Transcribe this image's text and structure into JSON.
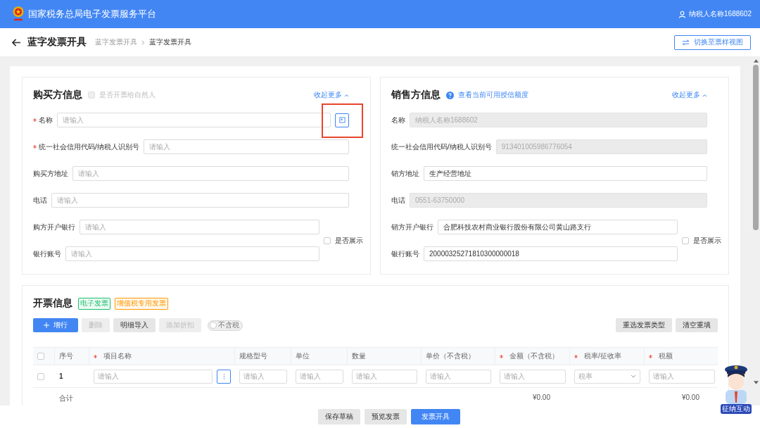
{
  "header": {
    "title": "国家税务总局电子发票服务平台",
    "user": "纳税人名称1688602"
  },
  "page": {
    "title": "蓝字发票开具",
    "breadcrumb": [
      {
        "label": "蓝字发票开具",
        "current": false
      },
      {
        "label": "蓝字发票开具",
        "current": true
      }
    ],
    "switch_button": "切换至票样视图"
  },
  "buyer": {
    "title": "购买方信息",
    "natural_person": {
      "label": "是否开票给自然人",
      "checked": false,
      "disabled": true
    },
    "collapse_link": "收起更多",
    "fields": [
      {
        "label": "名称",
        "required": true,
        "placeholder": "请输入",
        "picker": true,
        "highlighted": true
      },
      {
        "label": "统一社会信用代码/纳税人识别号",
        "required": true,
        "placeholder": "请输入"
      },
      {
        "label": "购买方地址",
        "required": false,
        "placeholder": "请输入"
      },
      {
        "label": "电话",
        "required": false,
        "placeholder": "请输入"
      }
    ],
    "bank_fields": [
      {
        "label": "购方开户银行",
        "required": false,
        "placeholder": "请输入"
      },
      {
        "label": "银行账号",
        "required": false,
        "placeholder": "请输入"
      }
    ],
    "show_option": {
      "label": "是否展示",
      "checked": false
    }
  },
  "seller": {
    "title": "销售方信息",
    "help": true,
    "quota_link": "查看当前可用授信额度",
    "collapse_link": "收起更多",
    "fields": [
      {
        "label": "名称",
        "value": "纳税人名称1688602",
        "disabled": true
      },
      {
        "label": "统一社会信用代码/纳税人识别号",
        "value": "913401005986776054",
        "disabled": true
      },
      {
        "label": "销方地址",
        "value": "生产经营地址",
        "disabled": false
      },
      {
        "label": "电话",
        "value": "0551-63750000",
        "disabled": true
      }
    ],
    "bank_fields": [
      {
        "label": "销方开户银行",
        "value": "合肥科技农村商业银行股份有限公司黄山路支行",
        "disabled": false
      },
      {
        "label": "银行账号",
        "value": "20000325271810300000018",
        "disabled": false
      }
    ],
    "show_option": {
      "label": "是否展示",
      "checked": false
    }
  },
  "invoice": {
    "title": "开票信息",
    "tags": [
      {
        "label": "电子发票",
        "color": "#19be6b"
      },
      {
        "label": "增值税专用发票",
        "color": "#ff9900"
      }
    ],
    "toolbar": [
      {
        "label": "增行",
        "kind": "add"
      },
      {
        "label": "删除",
        "kind": "disabled"
      },
      {
        "label": "明细导入",
        "kind": "default"
      },
      {
        "label": "添加折扣",
        "kind": "disabled"
      }
    ],
    "tax_toggle": {
      "label": "不含税",
      "on": false
    },
    "right_buttons": [
      {
        "label": "重选发票类型",
        "kind": "default"
      },
      {
        "label": "清空重填",
        "kind": "default"
      }
    ],
    "table": {
      "all_checked": false,
      "columns": [
        {
          "label": "序号",
          "required": false
        },
        {
          "label": "项目名称",
          "required": true
        },
        {
          "label": "规格型号",
          "required": false
        },
        {
          "label": "单位",
          "required": false
        },
        {
          "label": "数量",
          "required": false
        },
        {
          "label": "单价（不含税）",
          "required": false
        },
        {
          "label": "金额（不含税）",
          "required": true
        },
        {
          "label": "税率/征收率",
          "required": true
        },
        {
          "label": "税额",
          "required": true
        }
      ],
      "rows": [
        {
          "checked": false,
          "cells": [
            {
              "kind": "text",
              "text": "1"
            },
            {
              "kind": "input",
              "placeholder": "请输入",
              "more": true
            },
            {
              "kind": "input",
              "placeholder": "请输入"
            },
            {
              "kind": "input",
              "placeholder": "请输入"
            },
            {
              "kind": "input",
              "placeholder": "请输入"
            },
            {
              "kind": "input",
              "placeholder": "请输入"
            },
            {
              "kind": "input",
              "placeholder": "请输入"
            },
            {
              "kind": "select",
              "placeholder": "税率"
            },
            {
              "kind": "input",
              "placeholder": "请输入"
            }
          ]
        }
      ],
      "totals": {
        "label": "合计",
        "amount": "¥0.00",
        "tax": "¥0.00"
      }
    }
  },
  "footer": {
    "buttons": [
      {
        "label": "保存草稿",
        "kind": "default"
      },
      {
        "label": "预览发票",
        "kind": "default"
      },
      {
        "label": "发票开具",
        "kind": "primary"
      }
    ]
  },
  "assistant": {
    "label": "征纳互动"
  }
}
